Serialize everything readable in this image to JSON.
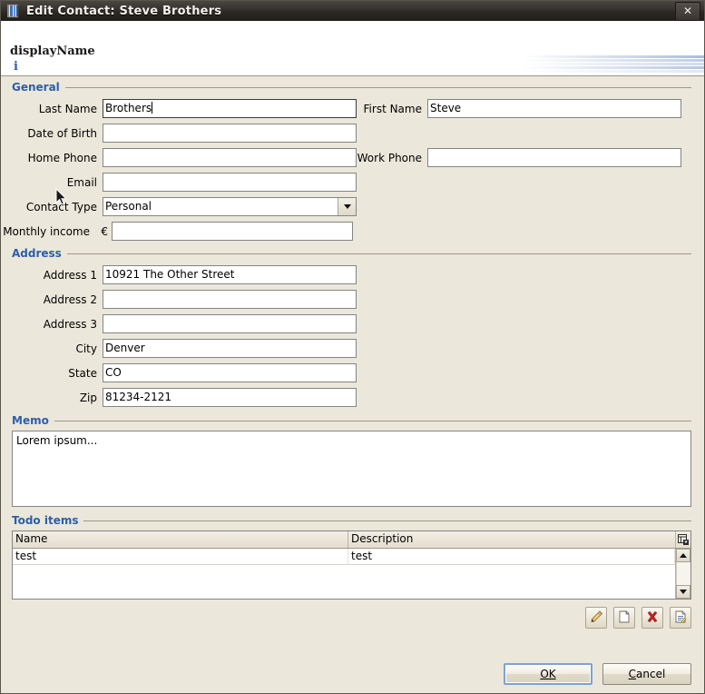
{
  "window": {
    "title": "Edit Contact: Steve Brothers",
    "icon": "address-book-icon",
    "close_label": "✕"
  },
  "banner": {
    "title": "displayName",
    "subtitle": "i"
  },
  "general": {
    "group_label": "General",
    "fields": {
      "last_name": {
        "label": "Last Name",
        "value": "Brothers",
        "placeholder": ""
      },
      "first_name": {
        "label": "First Name",
        "value": "Steve",
        "placeholder": ""
      },
      "date_of_birth": {
        "label": "Date of Birth",
        "value": "",
        "placeholder": ""
      },
      "home_phone": {
        "label": "Home Phone",
        "value": "",
        "placeholder": ""
      },
      "work_phone": {
        "label": "Work Phone",
        "value": "",
        "placeholder": ""
      },
      "email": {
        "label": "Email",
        "value": "",
        "placeholder": ""
      },
      "contact_type": {
        "label": "Contact Type",
        "value": "Personal",
        "options": [
          "Personal"
        ]
      },
      "monthly_income": {
        "label": "Monthly income",
        "currency": "€",
        "value": "",
        "placeholder": ""
      }
    }
  },
  "address": {
    "group_label": "Address",
    "fields": {
      "address1": {
        "label": "Address 1",
        "value": "10921 The Other Street"
      },
      "address2": {
        "label": "Address 2",
        "value": ""
      },
      "address3": {
        "label": "Address 3",
        "value": ""
      },
      "city": {
        "label": "City",
        "value": "Denver"
      },
      "state": {
        "label": "State",
        "value": "CO"
      },
      "zip": {
        "label": "Zip",
        "value": "81234-2121"
      }
    }
  },
  "memo": {
    "group_label": "Memo",
    "value": "Lorem ipsum...",
    "placeholder": ""
  },
  "todo": {
    "group_label": "Todo items",
    "columns": [
      "Name",
      "Description"
    ],
    "rows": [
      {
        "name": "test",
        "description": "test"
      }
    ],
    "toolbar": [
      {
        "name": "edit-item-button",
        "icon": "pencil-icon"
      },
      {
        "name": "new-item-button",
        "icon": "new-document-icon"
      },
      {
        "name": "delete-item-button",
        "icon": "red-x-icon"
      },
      {
        "name": "details-item-button",
        "icon": "document-details-icon"
      }
    ],
    "scrollbar": {
      "up": "scroll-up-arrow",
      "down": "scroll-down-arrow"
    },
    "column_chooser": "column-chooser-icon"
  },
  "footer": {
    "ok": {
      "label": "OK",
      "mnemonic": "O",
      "default": true
    },
    "cancel": {
      "label": "Cancel",
      "mnemonic": "C",
      "default": false
    }
  },
  "colors": {
    "background": "#ebe7da",
    "group_title": "#2b5fa8",
    "titlebar": "#2c2824",
    "field_bg": "#ffffff",
    "accent": "#7ba4d0",
    "delete": "#cc2222"
  }
}
